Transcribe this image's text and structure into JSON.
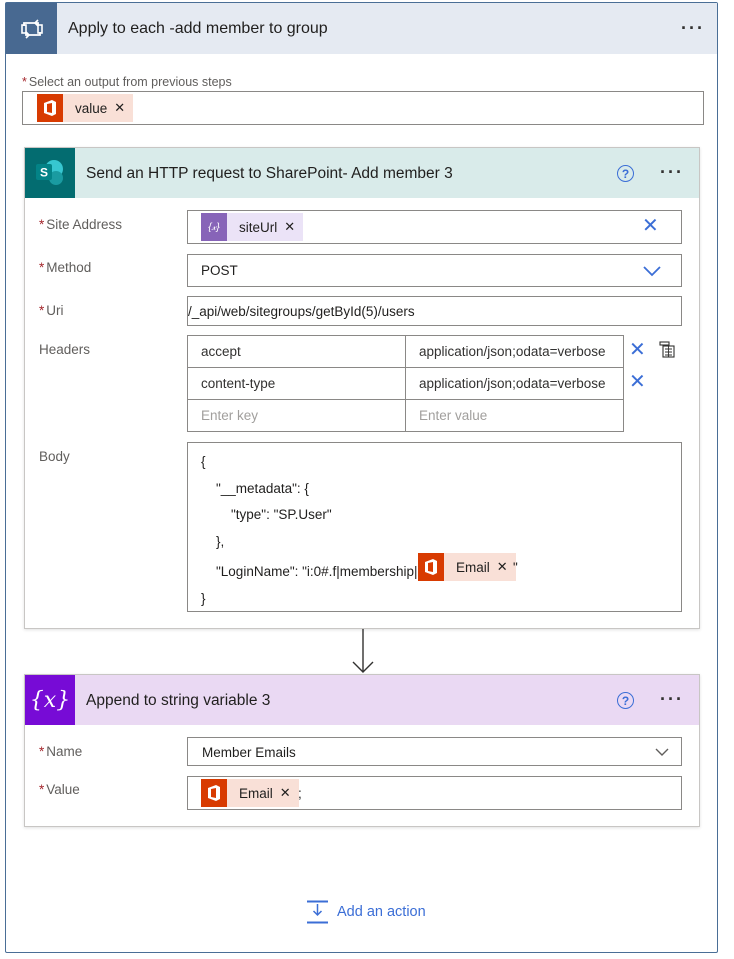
{
  "loop": {
    "title": "Apply to each -add member to group",
    "select_label": "Select an output from previous steps",
    "token_label": "value",
    "colors": {
      "header_bg": "#e5eaf2",
      "icon_bg": "#486991"
    }
  },
  "http_card": {
    "title": "Send an HTTP request to SharePoint- Add member 3",
    "site_address_label": "Site Address",
    "site_token": "siteUrl",
    "method_label": "Method",
    "method_value": "POST",
    "uri_label": "Uri",
    "uri_value": "/_api/web/sitegroups/getById(5)/users",
    "headers_label": "Headers",
    "headers": [
      {
        "key": "accept",
        "value": "application/json;odata=verbose"
      },
      {
        "key": "content-type",
        "value": "application/json;odata=verbose"
      }
    ],
    "key_placeholder": "Enter key",
    "value_placeholder": "Enter value",
    "body_label": "Body",
    "body_lines": [
      "{",
      "\"__metadata\": {",
      "\"type\": \"SP.User\"",
      "},",
      "\"LoginName\": \"i:0#.f|membership|",
      "}"
    ],
    "body_token": "Email",
    "body_suffix": "\"",
    "colors": {
      "header_bg": "#d9ebea",
      "icon_bg": "#036c70"
    }
  },
  "var_card": {
    "title": "Append to string variable 3",
    "icon_text": "{x}",
    "name_label": "Name",
    "name_value": "Member Emails",
    "value_label": "Value",
    "value_token": "Email",
    "value_suffix": ";",
    "colors": {
      "header_bg": "#ead9f3",
      "icon_bg": "#770bd6"
    }
  },
  "add_action_label": "Add an action",
  "req_mark": "*",
  "help_glyph": "?",
  "dots": "···"
}
